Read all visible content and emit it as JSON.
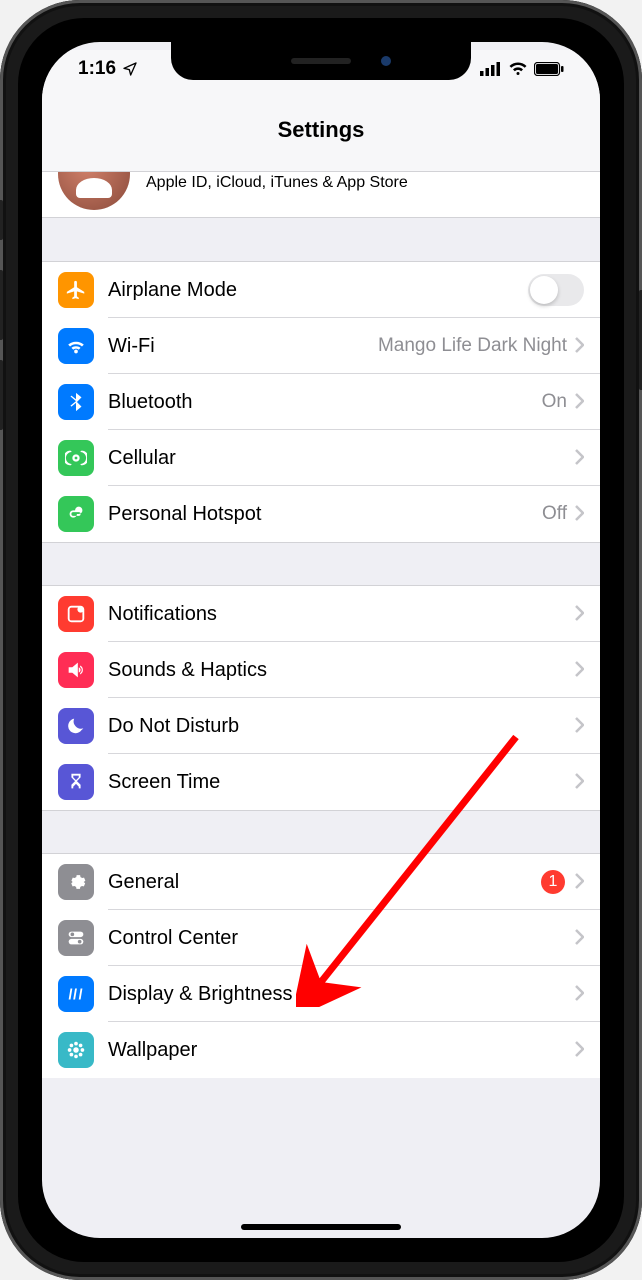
{
  "status": {
    "time": "1:16"
  },
  "header": {
    "title": "Settings"
  },
  "apple_id": {
    "subtitle": "Apple ID, iCloud, iTunes & App Store"
  },
  "group1": {
    "airplane": {
      "label": "Airplane Mode",
      "icon_bg": "#ff9500"
    },
    "wifi": {
      "label": "Wi-Fi",
      "value": "Mango Life Dark Night",
      "icon_bg": "#007aff"
    },
    "bluetooth": {
      "label": "Bluetooth",
      "value": "On",
      "icon_bg": "#007aff"
    },
    "cellular": {
      "label": "Cellular",
      "icon_bg": "#34c759"
    },
    "hotspot": {
      "label": "Personal Hotspot",
      "value": "Off",
      "icon_bg": "#34c759"
    }
  },
  "group2": {
    "notifications": {
      "label": "Notifications",
      "icon_bg": "#ff3b30"
    },
    "sounds": {
      "label": "Sounds & Haptics",
      "icon_bg": "#ff2d55"
    },
    "dnd": {
      "label": "Do Not Disturb",
      "icon_bg": "#5856d6"
    },
    "screentime": {
      "label": "Screen Time",
      "icon_bg": "#5856d6"
    }
  },
  "group3": {
    "general": {
      "label": "General",
      "badge": "1",
      "icon_bg": "#8e8e93"
    },
    "controlcenter": {
      "label": "Control Center",
      "icon_bg": "#8e8e93"
    },
    "display": {
      "label": "Display & Brightness",
      "icon_bg": "#007aff"
    },
    "wallpaper": {
      "label": "Wallpaper",
      "icon_bg": "#38b9c7"
    }
  }
}
